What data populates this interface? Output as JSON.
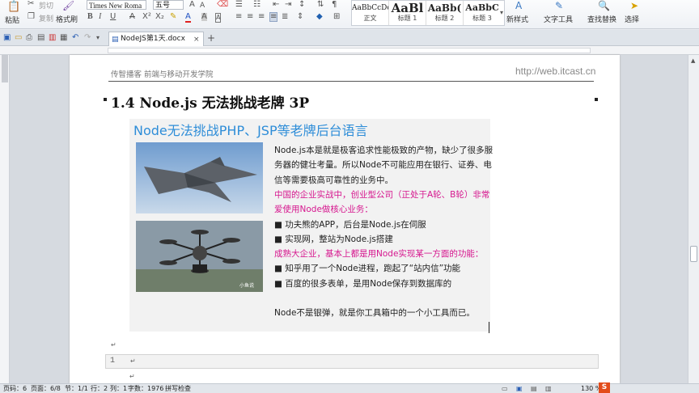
{
  "ribbon": {
    "paste": "粘贴",
    "cut": "剪切",
    "copy": "复制",
    "format_painter": "格式刷",
    "font_name": "Times New Roma",
    "font_size": "五号",
    "styles": [
      {
        "sample": "AaBbCcDd",
        "name": "正文"
      },
      {
        "sample": "AaBl",
        "name": "标题 1"
      },
      {
        "sample": "AaBb(",
        "name": "标题 2"
      },
      {
        "sample": "AaBbC",
        "name": "标题 3"
      }
    ],
    "new_style": "新样式",
    "text_tools": "文字工具",
    "find_replace": "查找替换",
    "select": "选择"
  },
  "tab": {
    "title": "NodeJS第1天.docx"
  },
  "document": {
    "header_left": "传智播客  前端与移动开发学院",
    "header_right": "http://web.itcast.cn",
    "heading": "1.4 Node.js 无法挑战老牌 3P",
    "slide": {
      "title": "Node无法挑战PHP、JSP等老牌后台语言",
      "watermark": "小鱼说",
      "lines": [
        {
          "text": "Node.js本是就是极客追求性能极致的产物，缺少了很多服",
          "color": "#222222"
        },
        {
          "text": "务器的健壮考量。所以Node不可能应用在银行、证券、电",
          "color": "#222222"
        },
        {
          "text": "信等需要极高可靠性的业务中。",
          "color": "#222222"
        },
        {
          "text": "中国的企业实战中，创业型公司（正处于A轮、B轮）非常",
          "color": "#d6168e"
        },
        {
          "text": "爱使用Node做核心业务：",
          "color": "#d6168e"
        },
        {
          "text": "■ 功夫熊的APP，后台是Node.js在伺服",
          "color": "#222222"
        },
        {
          "text": "■ 实现网，整站为Node.js搭建",
          "color": "#222222"
        },
        {
          "text": "成熟大企业，基本上都是用Node实现某一方面的功能：",
          "color": "#d6168e"
        },
        {
          "text": "■ 知乎用了一个Node进程，跑起了“站内信”功能",
          "color": "#222222"
        },
        {
          "text": "■ 百度的很多表单，是用Node保存到数据库的",
          "color": "#222222"
        },
        {
          "text": "",
          "color": "#222222"
        },
        {
          "text": "Node不是银弹，就是你工具箱中的一个小工具而已。",
          "color": "#222222"
        }
      ]
    },
    "code_line_number": "1"
  },
  "status": {
    "page": "页码：6",
    "pages": "页面：6/8",
    "section": "节：1/1",
    "row": "行：2",
    "col": "列：1",
    "words": "字数：1976",
    "spell_check": "拼写检查",
    "zoom": "130 %"
  },
  "colors": {
    "accent": "#2e8dd8",
    "pink": "#d6168e"
  }
}
